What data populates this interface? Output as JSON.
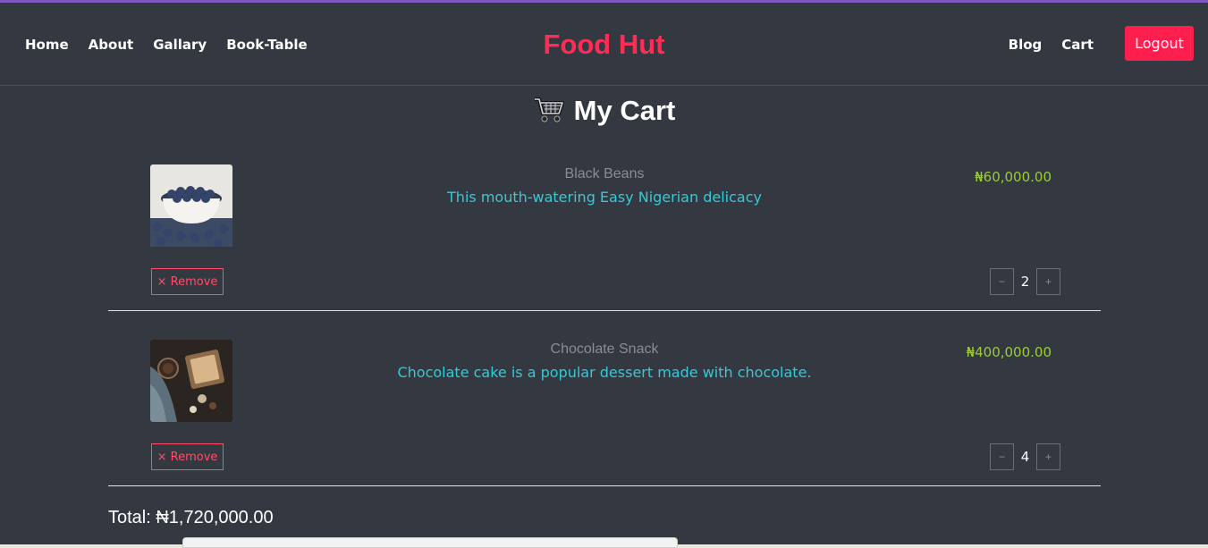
{
  "nav": {
    "left_links": [
      "Home",
      "About",
      "Gallary",
      "Book-Table"
    ],
    "brand": "Food Hut",
    "right_links": [
      "Blog",
      "Cart"
    ],
    "logout_label": "Logout"
  },
  "cart": {
    "title": "My Cart",
    "title_icon": "shopping-cart-icon",
    "items": [
      {
        "name": "Black Beans",
        "description": "This mouth-watering Easy Nigerian delicacy",
        "price": "₦60,000.00",
        "quantity": "2",
        "remove_label": "× Remove",
        "minus_label": "−",
        "plus_label": "+",
        "image": "blueberries-bowl-image"
      },
      {
        "name": "Chocolate Snack",
        "description": "Chocolate cake is a popular dessert made with chocolate.",
        "price": "₦400,000.00",
        "quantity": "4",
        "remove_label": "× Remove",
        "minus_label": "−",
        "plus_label": "+",
        "image": "chocolate-snack-image"
      }
    ],
    "total": "Total: ₦1,720,000.00"
  },
  "colors": {
    "background": "#343840",
    "brand": "#ff2d55",
    "logout": "#ff1f4f",
    "price": "#9ccc3a",
    "description": "#36c9d6",
    "remove": "#ff4d6a"
  }
}
